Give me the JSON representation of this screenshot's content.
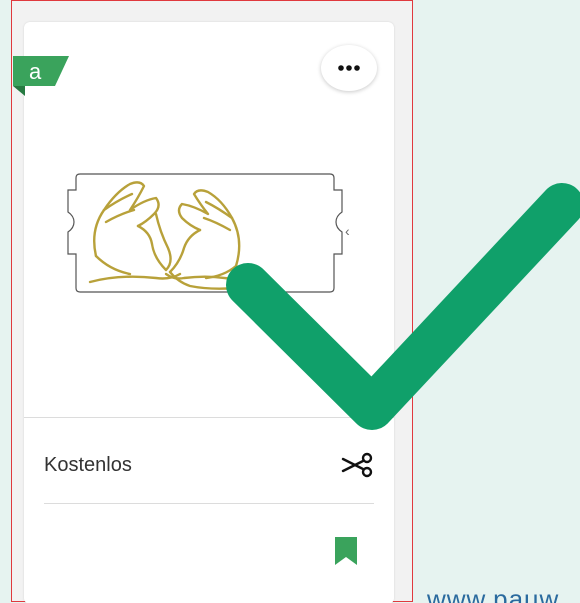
{
  "card": {
    "badge_label": "a",
    "price_label": "Kostenlos"
  },
  "footer": {
    "url_text": "www.pauw"
  },
  "icons": {
    "more": "more-horizontal-icon",
    "cut": "scissors-icon",
    "bookmark": "bookmark-icon",
    "check": "checkmark-icon"
  },
  "colors": {
    "brand_green": "#3aa35c",
    "check_green": "#10a06a",
    "frame_red": "#e0393e",
    "background": "#e6f3f0"
  }
}
